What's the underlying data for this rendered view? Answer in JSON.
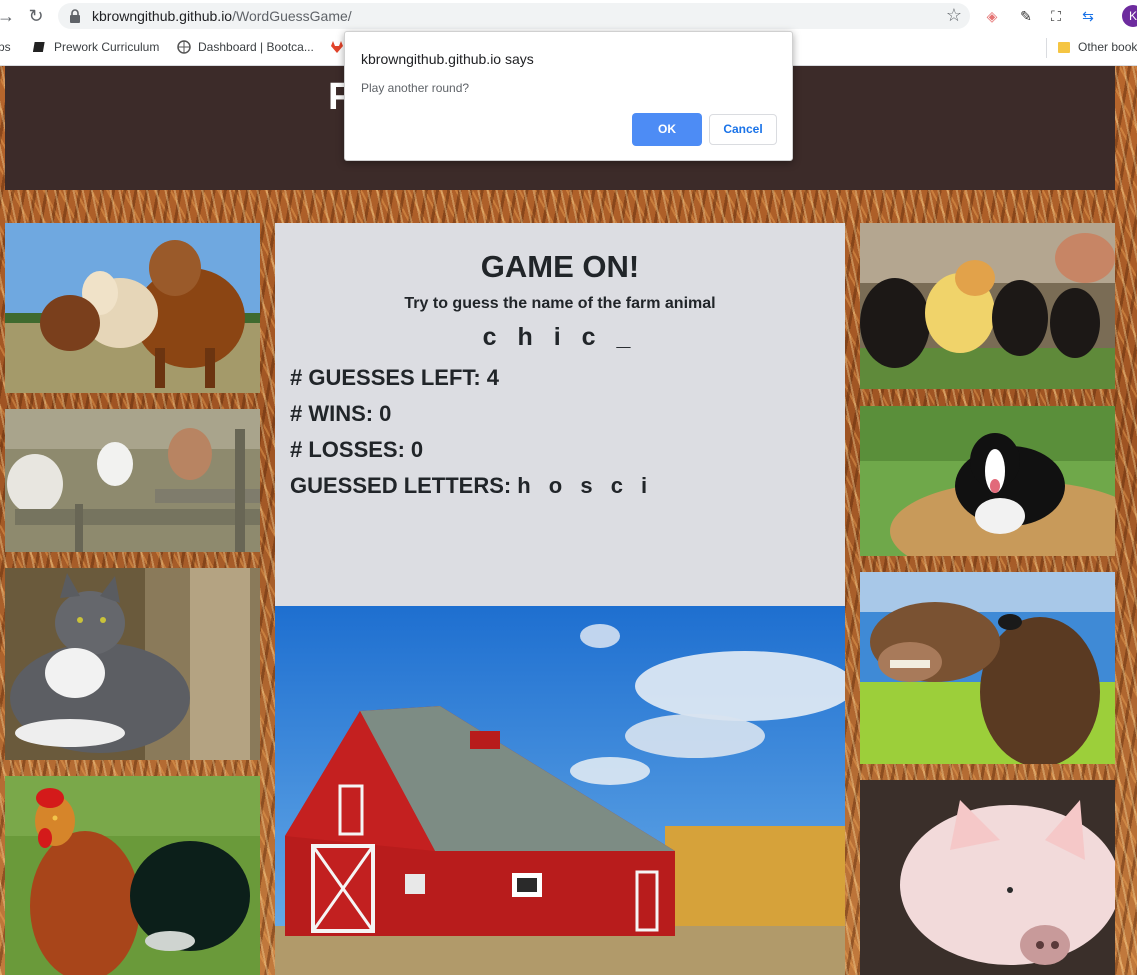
{
  "browser": {
    "url_host": "kbrowngithub.github.io",
    "url_path": "/WordGuessGame/",
    "profile_initial": "K",
    "bookmarks": [
      {
        "label": "ps"
      },
      {
        "label": "Prework Curriculum"
      },
      {
        "label": "Dashboard | Bootca..."
      },
      {
        "label": "Other book"
      }
    ]
  },
  "header": {
    "title_visible": "F"
  },
  "game": {
    "title": "GAME ON!",
    "subtitle": "Try to guess the name of the farm animal",
    "word": "c h i c _",
    "guesses_left_label": "# GUESSES LEFT:",
    "guesses_left": "4",
    "wins_label": "# WINS:",
    "wins": "0",
    "losses_label": "# LOSSES:",
    "losses": "0",
    "guessed_label": "GUESSED LETTERS:",
    "guessed_letters": "h o s c i"
  },
  "dialog": {
    "title": "kbrowngithub.github.io says",
    "message": "Play another round?",
    "ok_label": "OK",
    "cancel_label": "Cancel"
  },
  "images": {
    "left": [
      "cows-photo",
      "sheep-photo",
      "cat-photo",
      "rooster-photo"
    ],
    "right": [
      "chicks-photo",
      "dog-photo",
      "horse-photo",
      "pig-photo"
    ],
    "center": "barn-photo"
  },
  "colors": {
    "header_bg": "#3c2b29",
    "panel_bg": "#dcdde2",
    "ok_button": "#4d8cf5",
    "cancel_text": "#1a73e8"
  }
}
